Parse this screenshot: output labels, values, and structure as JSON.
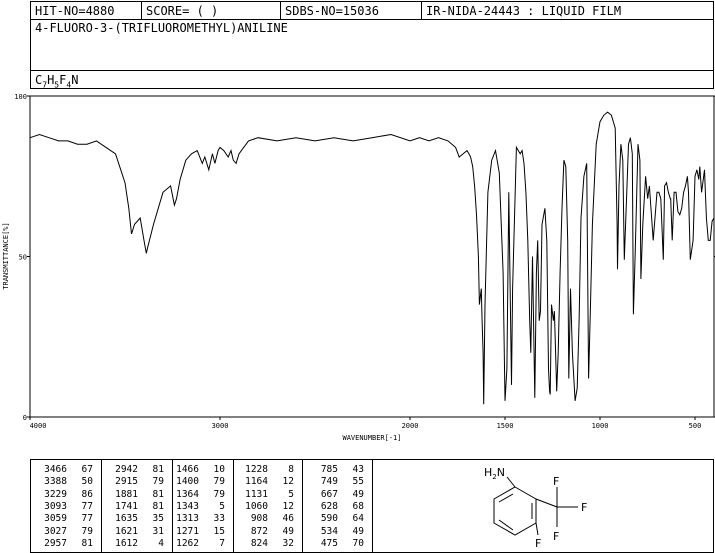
{
  "header": {
    "hit_no": "HIT-NO=4880",
    "score": "SCORE=  (   )",
    "sdbs_no": "SDBS-NO=15036",
    "ir_info": "IR-NIDA-24443 : LIQUID FILM",
    "compound_name": "4-FLUORO-3-(TRIFLUOROMETHYL)ANILINE",
    "formula_parts": [
      {
        "t": "C",
        "sub": false
      },
      {
        "t": "7",
        "sub": true
      },
      {
        "t": "H",
        "sub": false
      },
      {
        "t": "5",
        "sub": true
      },
      {
        "t": "F",
        "sub": false
      },
      {
        "t": "4",
        "sub": true
      },
      {
        "t": "N",
        "sub": false
      }
    ]
  },
  "chart_data": {
    "type": "line",
    "xlabel": "WAVENUMBER[-1]",
    "ylabel": "TRANSMITTANCE[%]",
    "xlim": [
      4000,
      400
    ],
    "ylim": [
      0,
      100
    ],
    "x_ticks": [
      4000,
      3000,
      2000,
      1500,
      1000,
      500
    ],
    "y_ticks": [
      0,
      50,
      100
    ],
    "series": [
      {
        "x": [
          4000,
          3950,
          3900,
          3850,
          3800,
          3750,
          3700,
          3650,
          3600,
          3550,
          3500,
          3480,
          3466,
          3450,
          3420,
          3400,
          3388,
          3380,
          3350,
          3300,
          3260,
          3240,
          3229,
          3210,
          3180,
          3150,
          3120,
          3100,
          3093,
          3080,
          3059,
          3040,
          3027,
          3010,
          3000,
          2980,
          2957,
          2942,
          2930,
          2915,
          2900,
          2850,
          2800,
          2700,
          2600,
          2500,
          2400,
          2300,
          2200,
          2100,
          2000,
          1950,
          1900,
          1850,
          1800,
          1760,
          1741,
          1720,
          1700,
          1690,
          1681,
          1670,
          1660,
          1650,
          1640,
          1635,
          1625,
          1621,
          1615,
          1612,
          1605,
          1590,
          1570,
          1550,
          1530,
          1510,
          1500,
          1490,
          1480,
          1466,
          1460,
          1440,
          1420,
          1410,
          1400,
          1390,
          1380,
          1370,
          1364,
          1355,
          1343,
          1335,
          1328,
          1320,
          1313,
          1305,
          1290,
          1280,
          1271,
          1265,
          1262,
          1255,
          1245,
          1240,
          1228,
          1220,
          1210,
          1200,
          1190,
          1180,
          1170,
          1164,
          1155,
          1145,
          1131,
          1120,
          1110,
          1100,
          1085,
          1070,
          1060,
          1050,
          1040,
          1020,
          1000,
          980,
          960,
          940,
          920,
          910,
          908,
          900,
          890,
          880,
          872,
          865,
          850,
          840,
          830,
          824,
          815,
          800,
          790,
          785,
          775,
          760,
          749,
          740,
          720,
          700,
          690,
          680,
          667,
          660,
          650,
          640,
          630,
          628,
          620,
          610,
          600,
          590,
          580,
          570,
          560,
          550,
          540,
          534,
          525,
          510,
          500,
          490,
          480,
          475,
          465,
          450,
          440,
          430,
          420,
          410,
          400
        ],
        "y": [
          87,
          88,
          87,
          86,
          86,
          85,
          85,
          86,
          84,
          82,
          73,
          65,
          57,
          60,
          62,
          55,
          51,
          53,
          60,
          70,
          72,
          66,
          68,
          74,
          80,
          82,
          83,
          80,
          79,
          81,
          77,
          82,
          79,
          83,
          84,
          83,
          81,
          83,
          80,
          79,
          82,
          86,
          87,
          86,
          87,
          86,
          87,
          86,
          87,
          88,
          86,
          87,
          86,
          87,
          86,
          84,
          81,
          82,
          83,
          82,
          81,
          78,
          72,
          63,
          50,
          35,
          40,
          31,
          20,
          4,
          35,
          70,
          80,
          83,
          76,
          45,
          5,
          15,
          70,
          10,
          40,
          84,
          82,
          83,
          79,
          70,
          55,
          30,
          20,
          50,
          6,
          45,
          55,
          30,
          33,
          60,
          65,
          55,
          15,
          8,
          7,
          35,
          30,
          33,
          8,
          20,
          45,
          65,
          80,
          78,
          55,
          12,
          40,
          20,
          5,
          9,
          30,
          62,
          75,
          79,
          12,
          35,
          60,
          85,
          92,
          94,
          95,
          94,
          90,
          60,
          46,
          72,
          85,
          80,
          49,
          60,
          85,
          87,
          82,
          32,
          50,
          85,
          80,
          43,
          60,
          75,
          68,
          72,
          55,
          70,
          70,
          68,
          49,
          72,
          73,
          70,
          68,
          68,
          55,
          70,
          70,
          64,
          63,
          65,
          70,
          72,
          75,
          70,
          49,
          55,
          75,
          77,
          74,
          78,
          70,
          77,
          62,
          55,
          55,
          61,
          62
        ]
      }
    ]
  },
  "peak_table": {
    "columns": [
      [
        [
          "3466",
          "67"
        ],
        [
          "3388",
          "50"
        ],
        [
          "3229",
          "86"
        ],
        [
          "3093",
          "77"
        ],
        [
          "3059",
          "77"
        ],
        [
          "3027",
          "79"
        ],
        [
          "2957",
          "81"
        ]
      ],
      [
        [
          "2942",
          "81"
        ],
        [
          "2915",
          "79"
        ],
        [
          "1881",
          "81"
        ],
        [
          "1741",
          "81"
        ],
        [
          "1635",
          "35"
        ],
        [
          "1621",
          "31"
        ],
        [
          "1612",
          "4"
        ]
      ],
      [
        [
          "1466",
          "10"
        ],
        [
          "1400",
          "79"
        ],
        [
          "1364",
          "79"
        ],
        [
          "1343",
          "5"
        ],
        [
          "1313",
          "33"
        ],
        [
          "1271",
          "15"
        ],
        [
          "1262",
          "7"
        ]
      ],
      [
        [
          "1228",
          "8"
        ],
        [
          "1164",
          "12"
        ],
        [
          "1131",
          "5"
        ],
        [
          "1060",
          "12"
        ],
        [
          "908",
          "46"
        ],
        [
          "872",
          "49"
        ],
        [
          "824",
          "32"
        ]
      ],
      [
        [
          "785",
          "43"
        ],
        [
          "749",
          "55"
        ],
        [
          "667",
          "49"
        ],
        [
          "628",
          "68"
        ],
        [
          "590",
          "64"
        ],
        [
          "534",
          "49"
        ],
        [
          "475",
          "70"
        ]
      ]
    ]
  },
  "structure": {
    "nh2_label": "H2N",
    "f_labels": [
      "F",
      "F",
      "F",
      "F"
    ]
  }
}
